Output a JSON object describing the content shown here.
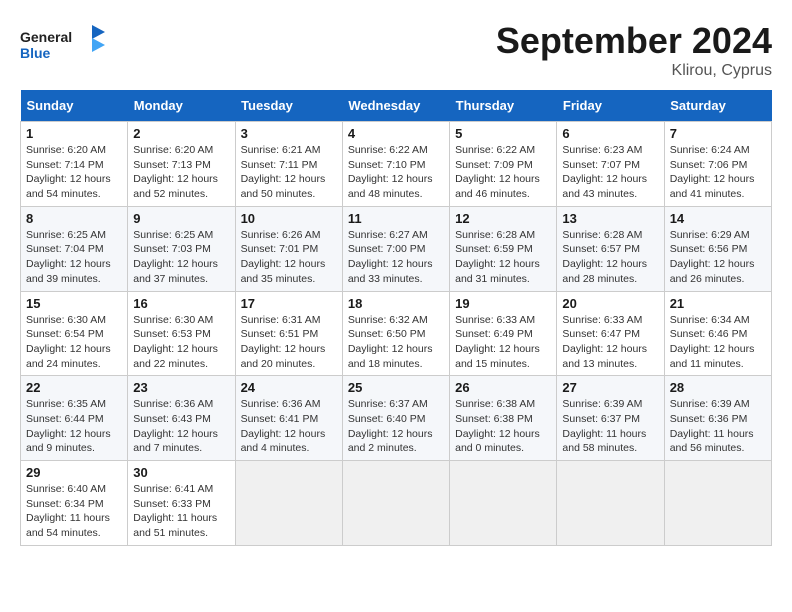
{
  "header": {
    "logo_general": "General",
    "logo_blue": "Blue",
    "month_title": "September 2024",
    "location": "Klirou, Cyprus"
  },
  "days_of_week": [
    "Sunday",
    "Monday",
    "Tuesday",
    "Wednesday",
    "Thursday",
    "Friday",
    "Saturday"
  ],
  "weeks": [
    [
      {
        "day": "1",
        "info": "Sunrise: 6:20 AM\nSunset: 7:14 PM\nDaylight: 12 hours\nand 54 minutes."
      },
      {
        "day": "2",
        "info": "Sunrise: 6:20 AM\nSunset: 7:13 PM\nDaylight: 12 hours\nand 52 minutes."
      },
      {
        "day": "3",
        "info": "Sunrise: 6:21 AM\nSunset: 7:11 PM\nDaylight: 12 hours\nand 50 minutes."
      },
      {
        "day": "4",
        "info": "Sunrise: 6:22 AM\nSunset: 7:10 PM\nDaylight: 12 hours\nand 48 minutes."
      },
      {
        "day": "5",
        "info": "Sunrise: 6:22 AM\nSunset: 7:09 PM\nDaylight: 12 hours\nand 46 minutes."
      },
      {
        "day": "6",
        "info": "Sunrise: 6:23 AM\nSunset: 7:07 PM\nDaylight: 12 hours\nand 43 minutes."
      },
      {
        "day": "7",
        "info": "Sunrise: 6:24 AM\nSunset: 7:06 PM\nDaylight: 12 hours\nand 41 minutes."
      }
    ],
    [
      {
        "day": "8",
        "info": "Sunrise: 6:25 AM\nSunset: 7:04 PM\nDaylight: 12 hours\nand 39 minutes."
      },
      {
        "day": "9",
        "info": "Sunrise: 6:25 AM\nSunset: 7:03 PM\nDaylight: 12 hours\nand 37 minutes."
      },
      {
        "day": "10",
        "info": "Sunrise: 6:26 AM\nSunset: 7:01 PM\nDaylight: 12 hours\nand 35 minutes."
      },
      {
        "day": "11",
        "info": "Sunrise: 6:27 AM\nSunset: 7:00 PM\nDaylight: 12 hours\nand 33 minutes."
      },
      {
        "day": "12",
        "info": "Sunrise: 6:28 AM\nSunset: 6:59 PM\nDaylight: 12 hours\nand 31 minutes."
      },
      {
        "day": "13",
        "info": "Sunrise: 6:28 AM\nSunset: 6:57 PM\nDaylight: 12 hours\nand 28 minutes."
      },
      {
        "day": "14",
        "info": "Sunrise: 6:29 AM\nSunset: 6:56 PM\nDaylight: 12 hours\nand 26 minutes."
      }
    ],
    [
      {
        "day": "15",
        "info": "Sunrise: 6:30 AM\nSunset: 6:54 PM\nDaylight: 12 hours\nand 24 minutes."
      },
      {
        "day": "16",
        "info": "Sunrise: 6:30 AM\nSunset: 6:53 PM\nDaylight: 12 hours\nand 22 minutes."
      },
      {
        "day": "17",
        "info": "Sunrise: 6:31 AM\nSunset: 6:51 PM\nDaylight: 12 hours\nand 20 minutes."
      },
      {
        "day": "18",
        "info": "Sunrise: 6:32 AM\nSunset: 6:50 PM\nDaylight: 12 hours\nand 18 minutes."
      },
      {
        "day": "19",
        "info": "Sunrise: 6:33 AM\nSunset: 6:49 PM\nDaylight: 12 hours\nand 15 minutes."
      },
      {
        "day": "20",
        "info": "Sunrise: 6:33 AM\nSunset: 6:47 PM\nDaylight: 12 hours\nand 13 minutes."
      },
      {
        "day": "21",
        "info": "Sunrise: 6:34 AM\nSunset: 6:46 PM\nDaylight: 12 hours\nand 11 minutes."
      }
    ],
    [
      {
        "day": "22",
        "info": "Sunrise: 6:35 AM\nSunset: 6:44 PM\nDaylight: 12 hours\nand 9 minutes."
      },
      {
        "day": "23",
        "info": "Sunrise: 6:36 AM\nSunset: 6:43 PM\nDaylight: 12 hours\nand 7 minutes."
      },
      {
        "day": "24",
        "info": "Sunrise: 6:36 AM\nSunset: 6:41 PM\nDaylight: 12 hours\nand 4 minutes."
      },
      {
        "day": "25",
        "info": "Sunrise: 6:37 AM\nSunset: 6:40 PM\nDaylight: 12 hours\nand 2 minutes."
      },
      {
        "day": "26",
        "info": "Sunrise: 6:38 AM\nSunset: 6:38 PM\nDaylight: 12 hours\nand 0 minutes."
      },
      {
        "day": "27",
        "info": "Sunrise: 6:39 AM\nSunset: 6:37 PM\nDaylight: 11 hours\nand 58 minutes."
      },
      {
        "day": "28",
        "info": "Sunrise: 6:39 AM\nSunset: 6:36 PM\nDaylight: 11 hours\nand 56 minutes."
      }
    ],
    [
      {
        "day": "29",
        "info": "Sunrise: 6:40 AM\nSunset: 6:34 PM\nDaylight: 11 hours\nand 54 minutes."
      },
      {
        "day": "30",
        "info": "Sunrise: 6:41 AM\nSunset: 6:33 PM\nDaylight: 11 hours\nand 51 minutes."
      },
      {
        "day": "",
        "info": ""
      },
      {
        "day": "",
        "info": ""
      },
      {
        "day": "",
        "info": ""
      },
      {
        "day": "",
        "info": ""
      },
      {
        "day": "",
        "info": ""
      }
    ]
  ]
}
